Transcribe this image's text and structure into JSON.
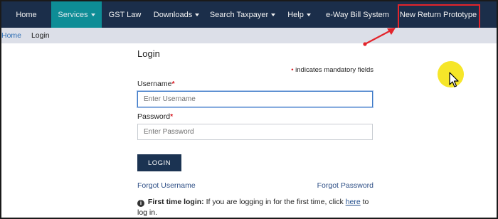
{
  "nav": {
    "items": [
      {
        "label": "Home",
        "has_caret": false
      },
      {
        "label": "Services",
        "has_caret": true
      },
      {
        "label": "GST Law",
        "has_caret": false
      },
      {
        "label": "Downloads",
        "has_caret": true
      },
      {
        "label": "Search Taxpayer",
        "has_caret": true
      },
      {
        "label": "Help",
        "has_caret": true
      },
      {
        "label": "e-Way Bill System",
        "has_caret": false
      },
      {
        "label": "New Return Prototype",
        "has_caret": false
      }
    ],
    "active_item": "Services",
    "highlighted_item": "New Return Prototype"
  },
  "breadcrumb": {
    "home": "Home",
    "current": "Login"
  },
  "login": {
    "title": "Login",
    "mandatory_marker": "•",
    "mandatory_note": "indicates mandatory fields",
    "username_label": "Username",
    "username_placeholder": "Enter Username",
    "password_label": "Password",
    "password_placeholder": "Enter Password",
    "required_marker": "*",
    "login_button": "LOGIN",
    "forgot_username": "Forgot Username",
    "forgot_password": "Forgot Password",
    "first_time_heading": "First time login:",
    "first_time_text": "If you are logging in for the first time, click",
    "first_time_link": "here",
    "first_time_suffix": "to log in."
  },
  "colors": {
    "navbar_bg": "#1b2e4a",
    "active_tab_bg": "#0e8d96",
    "annotation_red": "#e3242b",
    "cursor_highlight": "#f6e51e",
    "login_button_bg": "#1b3352"
  }
}
